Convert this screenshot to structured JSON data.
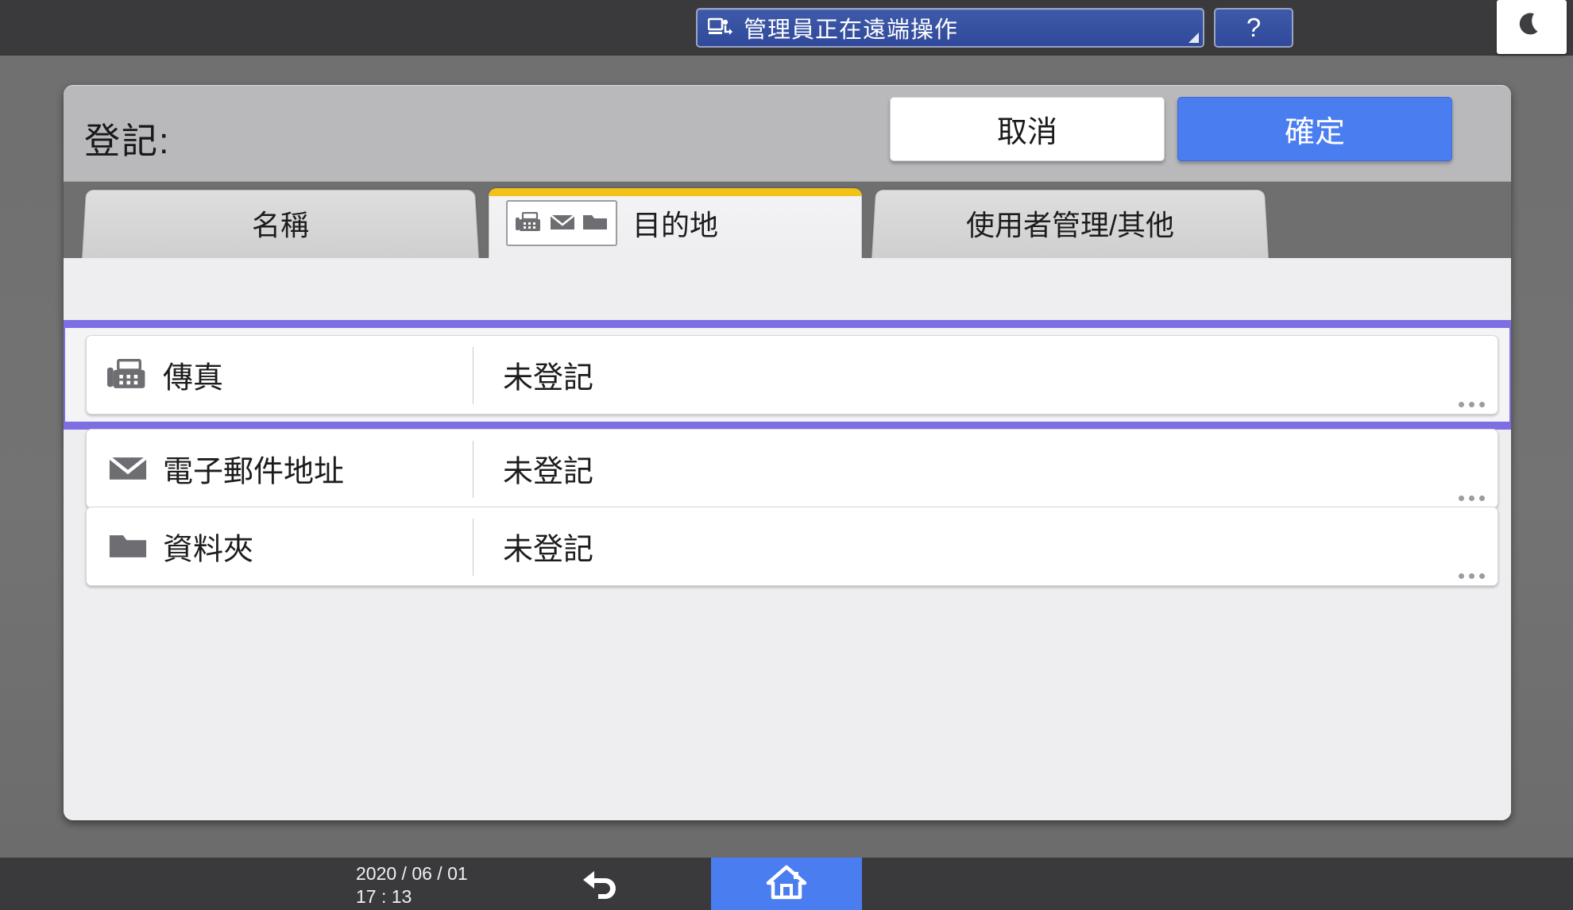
{
  "topbar": {
    "remote_status": {
      "icon": "remote-operation-icon",
      "text": "管理員正在遠端操作"
    },
    "help_label": "?",
    "sleep_icon": "moon-icon"
  },
  "dialog": {
    "title": "登記:",
    "cancel_label": "取消",
    "ok_label": "確定",
    "tabs": [
      {
        "id": "name",
        "label": "名稱",
        "active": false,
        "icons": []
      },
      {
        "id": "dest",
        "label": "目的地",
        "active": true,
        "icons": [
          "fax-icon",
          "envelope-icon",
          "folder-icon"
        ]
      },
      {
        "id": "usermgmt",
        "label": "使用者管理/其他",
        "active": false,
        "icons": []
      }
    ],
    "rows": [
      {
        "icon": "fax-icon",
        "label": "傳真",
        "value": "未登記",
        "selected": true
      },
      {
        "icon": "envelope-icon",
        "label": "電子郵件地址",
        "value": "未登記",
        "selected": false
      },
      {
        "icon": "folder-icon",
        "label": "資料夾",
        "value": "未登記",
        "selected": false
      }
    ]
  },
  "bottombar": {
    "date": "2020 / 06 / 01",
    "time": "17 : 13",
    "back_icon": "back-arrow-icon",
    "home_icon": "home-icon"
  },
  "colors": {
    "accent_blue": "#4a7df0",
    "status_blue": "#31499b",
    "selection_purple": "#7d6fe3",
    "tab_active_yellow": "#f2c218",
    "panel_bg": "#eeedf0",
    "header_gray": "#b9b9bb",
    "bar_dark": "#3a3a3c"
  }
}
